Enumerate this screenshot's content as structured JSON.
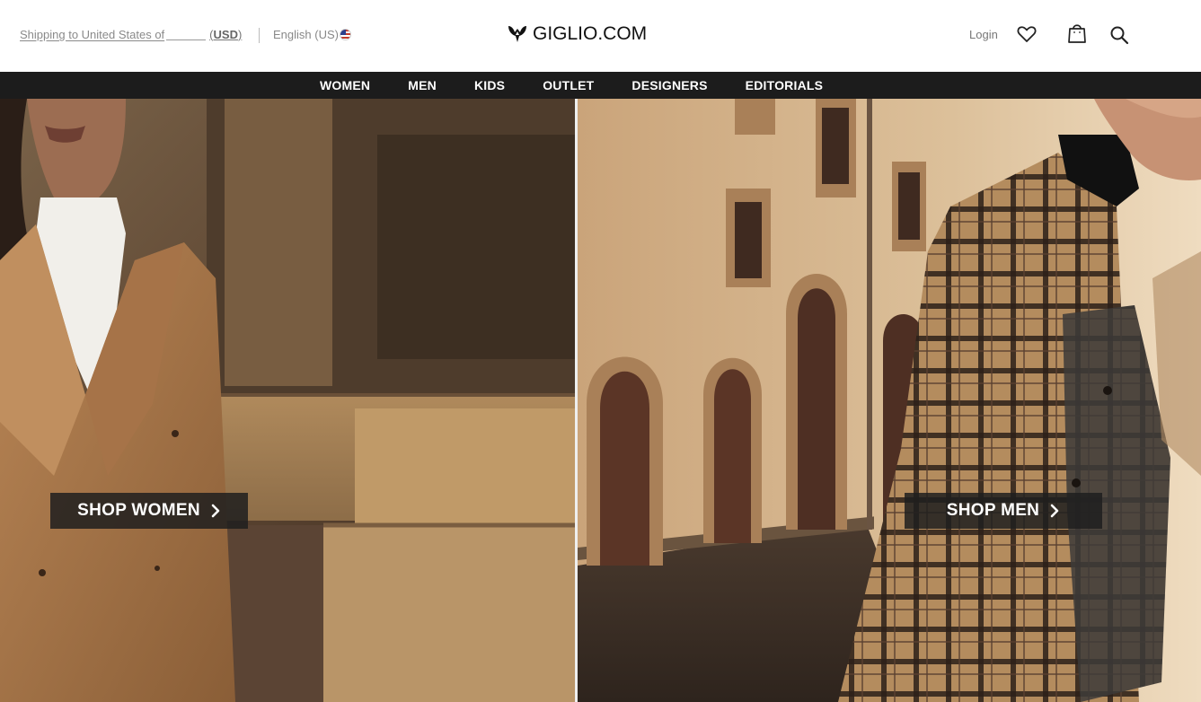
{
  "header": {
    "shipping_text": "Shipping to United States of",
    "currency": "USD",
    "language": "English (US)",
    "logo_text": "GIGLIO.COM",
    "login_label": "Login"
  },
  "nav": {
    "items": [
      "WOMEN",
      "MEN",
      "KIDS",
      "OUTLET",
      "DESIGNERS",
      "EDITORIALS"
    ]
  },
  "hero": {
    "left_cta": "SHOP WOMEN",
    "right_cta": "SHOP MEN"
  },
  "colors": {
    "nav_bg": "#1c1c1c",
    "cta_bg": "#1e1e1e"
  },
  "icons": [
    "logo-mark-icon",
    "flag-us-icon",
    "heart-icon",
    "shopping-bag-icon",
    "search-icon",
    "chevron-right-icon"
  ]
}
